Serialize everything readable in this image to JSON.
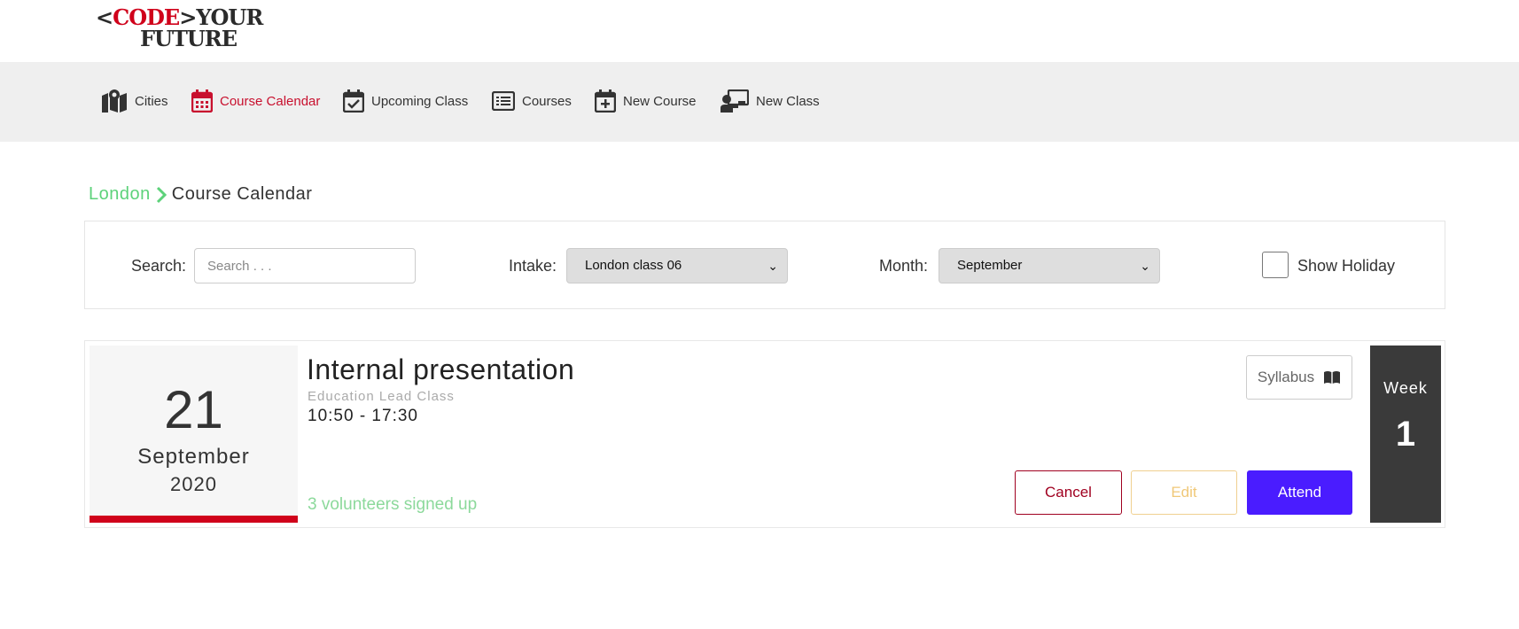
{
  "logo": {
    "part1_open": "<",
    "part1_red": "CODE",
    "part1_close": ">",
    "part1_rest": "YOUR",
    "part2": "FUTURE"
  },
  "nav": {
    "items": [
      {
        "label": "Cities",
        "icon": "map-marker-icon"
      },
      {
        "label": "Course Calendar",
        "icon": "calendar-icon",
        "active": true
      },
      {
        "label": "Upcoming Class",
        "icon": "calendar-check-icon"
      },
      {
        "label": "Courses",
        "icon": "list-icon"
      },
      {
        "label": "New Course",
        "icon": "calendar-plus-icon"
      },
      {
        "label": "New Class",
        "icon": "teacher-board-icon"
      }
    ],
    "active_color": "#c8102e"
  },
  "breadcrumb": {
    "city": "London",
    "page": "Course Calendar"
  },
  "filters": {
    "search_label": "Search:",
    "search_placeholder": "Search . . .",
    "intake_label": "Intake:",
    "intake_value": "London class 06",
    "month_label": "Month:",
    "month_value": "September",
    "holiday_label": "Show Holiday",
    "holiday_checked": false
  },
  "event": {
    "day": "21",
    "month": "September",
    "year": "2020",
    "title": "Internal presentation",
    "subtitle": "Education Lead Class",
    "time": "10:50 - 17:30",
    "volunteers": "3 volunteers signed up",
    "syllabus_label": "Syllabus",
    "cancel_label": "Cancel",
    "edit_label": "Edit",
    "attend_label": "Attend",
    "week_label": "Week",
    "week_number": "1"
  },
  "colors": {
    "brand_red": "#d0021b",
    "green": "#5dd27a",
    "attend_blue": "#4a1cff",
    "week_bg": "#3a3a3a"
  }
}
